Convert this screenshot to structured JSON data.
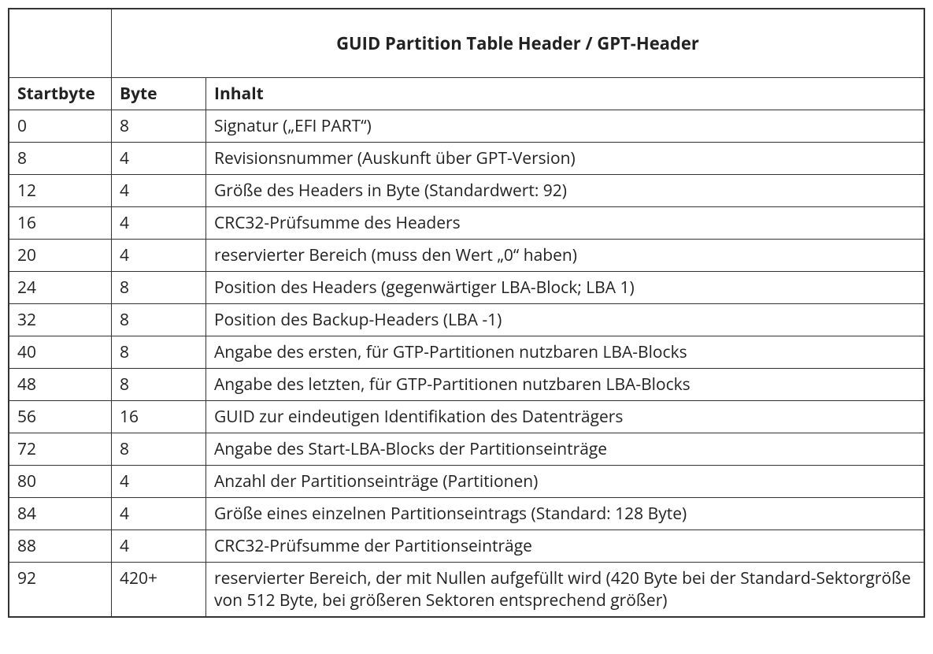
{
  "title": "GUID Partition Table Header / GPT-Header",
  "headers": {
    "startbyte": "Startbyte",
    "byte": "Byte",
    "inhalt": "Inhalt"
  },
  "rows": [
    {
      "startbyte": "0",
      "byte": "8",
      "inhalt": "Signatur („EFI PART“)"
    },
    {
      "startbyte": "8",
      "byte": "4",
      "inhalt": "Revisionsnummer (Auskunft über GPT-Version)"
    },
    {
      "startbyte": "12",
      "byte": "4",
      "inhalt": "Größe des Headers in Byte (Standardwert: 92)"
    },
    {
      "startbyte": "16",
      "byte": "4",
      "inhalt": "CRC32-Prüfsumme des Headers"
    },
    {
      "startbyte": "20",
      "byte": "4",
      "inhalt": "reservierter Bereich (muss den Wert „0“ haben)"
    },
    {
      "startbyte": "24",
      "byte": "8",
      "inhalt": "Position des Headers (gegenwärtiger LBA-Block; LBA 1)"
    },
    {
      "startbyte": "32",
      "byte": "8",
      "inhalt": "Position des Backup-Headers (LBA -1)"
    },
    {
      "startbyte": "40",
      "byte": "8",
      "inhalt": "Angabe des ersten, für GTP-Partitionen nutzbaren LBA-Blocks"
    },
    {
      "startbyte": "48",
      "byte": "8",
      "inhalt": "Angabe des letzten, für GTP-Partitionen nutzbaren LBA-Blocks"
    },
    {
      "startbyte": "56",
      "byte": "16",
      "inhalt": "GUID zur eindeutigen Identifikation des Datenträgers"
    },
    {
      "startbyte": "72",
      "byte": "8",
      "inhalt": "Angabe des Start-LBA-Blocks der Partitionseinträge"
    },
    {
      "startbyte": "80",
      "byte": "4",
      "inhalt": "Anzahl der Partitionseinträge (Partitionen)"
    },
    {
      "startbyte": "84",
      "byte": "4",
      "inhalt": "Größe eines einzelnen Partitionseintrags (Standard: 128 Byte)"
    },
    {
      "startbyte": "88",
      "byte": "4",
      "inhalt": "CRC32-Prüfsumme der Partitionseinträge"
    },
    {
      "startbyte": "92",
      "byte": "420+",
      "inhalt": "reservierter Bereich, der mit Nullen aufgefüllt wird (420 Byte bei der Standard-Sektorgröße von 512 Byte, bei größeren Sektoren entsprechend größer)"
    }
  ]
}
